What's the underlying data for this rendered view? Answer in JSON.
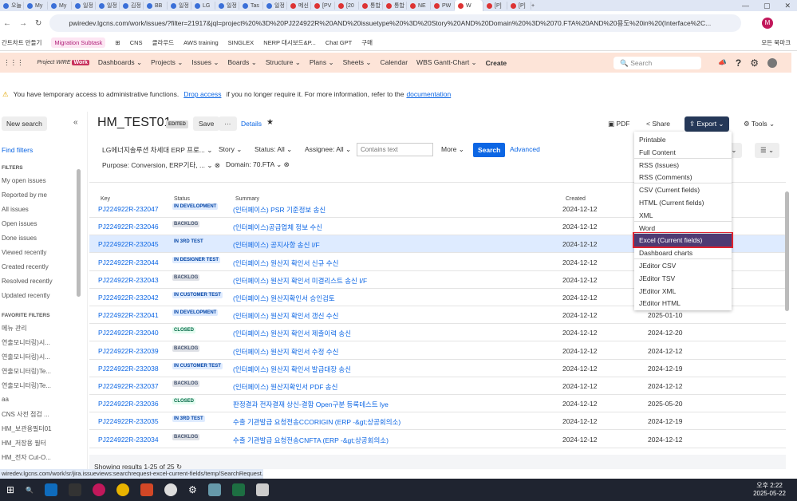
{
  "browser": {
    "tabs": [
      "오늘",
      "My",
      "My",
      "일정",
      "일정",
      "김정",
      "BB",
      "일정",
      "LG",
      "일정",
      "Tas",
      "일정",
      "메신",
      "[PV",
      "[20",
      "통합",
      "통합",
      "NE",
      "PW",
      "W",
      "[P]",
      "[P]"
    ],
    "active_tab_index": 19,
    "url": "pwiredev.lgcns.com/work/issues/?filter=21917&jql=project%20%3D%20PJ224922R%20AND%20issuetype%20%3D%20Story%20AND%20Domain%20%3D%2070.FTA%20AND%20용도%20in%20(Interface%2C...",
    "profile_initial": "M",
    "bookmarks": [
      "간트차트 만들기",
      "Migration Subtask",
      "CNS",
      "클라우드",
      "AWS training",
      "SINGLEX",
      "NERP 대시보드&P...",
      "Chat GPT",
      "구매"
    ],
    "all_bookmarks": "모든 북마크"
  },
  "nav": {
    "logo": "Project WIRE",
    "logo_badge": "Work",
    "items": [
      "Dashboards",
      "Projects",
      "Issues",
      "Boards",
      "Structure",
      "Plans",
      "Sheets",
      "Calendar",
      "WBS Gantt-Chart"
    ],
    "create": "Create",
    "search_placeholder": "Search"
  },
  "banner": {
    "pre": "You have temporary access to administrative functions.",
    "link1": "Drop access",
    "mid": "if you no longer require it. For more information, refer to the",
    "link2": "documentation",
    "end": "."
  },
  "sidebar": {
    "new_search": "New search",
    "find_filters": "Find filters",
    "filters_heading": "FILTERS",
    "filters": [
      "My open issues",
      "Reported by me",
      "All issues",
      "Open issues",
      "Done issues",
      "Viewed recently",
      "Created recently",
      "Resolved recently",
      "Updated recently"
    ],
    "favorites_heading": "FAVORITE FILTERS",
    "favorites": [
      "메뉴 관리",
      "연출모니터링)시...",
      "연출모니터링)시...",
      "연출모니터링)Te...",
      "연출모니터링)Te...",
      "aa",
      "CNS 사전 점검 ...",
      "HM_보관용필터01",
      "HM_저장용 필터",
      "HM_전자 Cut-O..."
    ]
  },
  "header": {
    "title": "HM_TEST01",
    "edited": "EDITED",
    "save": "Save",
    "more": "···",
    "details": "Details",
    "pdf": "PDF",
    "share": "Share",
    "export": "Export",
    "tools": "Tools"
  },
  "filters_bar": {
    "project": "LG에너지솔루션 차세대 ERP 프로...",
    "type": "Story",
    "status": "Status: All",
    "assignee": "Assignee: All",
    "contains_placeholder": "Contains text",
    "more": "More",
    "search": "Search",
    "advanced": "Advanced",
    "purpose": "Purpose: Conversion, ERP기타, ...",
    "domain": "Domain: 70.FTA",
    "columns": "ns"
  },
  "table": {
    "headers": [
      "Key",
      "Status",
      "Summary",
      "Created"
    ],
    "rows": [
      {
        "key": "PJ224922R-232047",
        "status": "IN DEVELOPMENT",
        "summary": "(인터페이스) PSR 기준정보 송신",
        "created": "2024-12-12",
        "updated": ""
      },
      {
        "key": "PJ224922R-232046",
        "status": "BACKLOG",
        "summary": "(인터페이스)공급업체 정보 수신",
        "created": "2024-12-12",
        "updated": ""
      },
      {
        "key": "PJ224922R-232045",
        "status": "IN 3RD TEST",
        "summary": "(인터페이스) 공지사항 송신 I/F",
        "created": "2024-12-12",
        "updated": ""
      },
      {
        "key": "PJ224922R-232044",
        "status": "IN DESIGNER TEST",
        "summary": "(인터페이스) 원산지 확인서 신규 수신",
        "created": "2024-12-12",
        "updated": ""
      },
      {
        "key": "PJ224922R-232043",
        "status": "BACKLOG",
        "summary": "(인터페이스) 원산지 확인서 미결리스트 송신 I/F",
        "created": "2024-12-12",
        "updated": ""
      },
      {
        "key": "PJ224922R-232042",
        "status": "IN CUSTOMER TEST",
        "summary": "(인터페이스) 원산지확인서 승인검토",
        "created": "2024-12-12",
        "updated": ""
      },
      {
        "key": "PJ224922R-232041",
        "status": "IN DEVELOPMENT",
        "summary": "(인터페이스) 원산지 확인서 갱신 수신",
        "created": "2024-12-12",
        "updated": "2025-01-10"
      },
      {
        "key": "PJ224922R-232040",
        "status": "CLOSED",
        "summary": "(인터페이스) 원산지 확인서 제출이력 송신",
        "created": "2024-12-12",
        "updated": "2024-12-20"
      },
      {
        "key": "PJ224922R-232039",
        "status": "BACKLOG",
        "summary": "(인터페이스) 원산지 확인서 수정 수신",
        "created": "2024-12-12",
        "updated": "2024-12-12"
      },
      {
        "key": "PJ224922R-232038",
        "status": "IN CUSTOMER TEST",
        "summary": "(인터페이스) 원산지 확인서 발급대장 송신",
        "created": "2024-12-12",
        "updated": "2024-12-19"
      },
      {
        "key": "PJ224922R-232037",
        "status": "BACKLOG",
        "summary": "(인터페이스) 원산지확인서 PDF 송신",
        "created": "2024-12-12",
        "updated": "2024-12-12"
      },
      {
        "key": "PJ224922R-232036",
        "status": "CLOSED",
        "summary": "판정결과 전자결재 상신-결함 Open구분 등록테스트 lye",
        "created": "2024-12-12",
        "updated": "2025-05-20"
      },
      {
        "key": "PJ224922R-232035",
        "status": "IN 3RD TEST",
        "summary": "수출 기관발급 요청전송CCORIGIN (ERP -&gt;상공회의소)",
        "created": "2024-12-12",
        "updated": "2024-12-19"
      },
      {
        "key": "PJ224922R-232034",
        "status": "BACKLOG",
        "summary": "수출 기관발급 요청전송CNFTA (ERP -&gt;상공회의소)",
        "created": "2024-12-12",
        "updated": "2024-12-12"
      }
    ],
    "footer": "Showing results 1-25 of 25"
  },
  "export_menu": [
    "Printable",
    "Full Content",
    "RSS (Issues)",
    "RSS (Comments)",
    "CSV (Current fields)",
    "HTML (Current fields)",
    "XML",
    "Word",
    "Excel (Current fields)",
    "Dashboard charts",
    "JEditor CSV",
    "JEditor TSV",
    "JEditor XML",
    "JEditor HTML"
  ],
  "status_url": "wiredev.lgcns.com/work/sr/jira.issueviews:searchrequest-excel-current-fields/temp/SearchRequest...",
  "taskbar": {
    "time": "오후 2:22",
    "date": "2025-05-22"
  },
  "colors": {
    "nav_bg": "#fde4d8",
    "accent": "#0c66e4",
    "export_bg": "#253858",
    "highlight": "#4e3a73"
  }
}
